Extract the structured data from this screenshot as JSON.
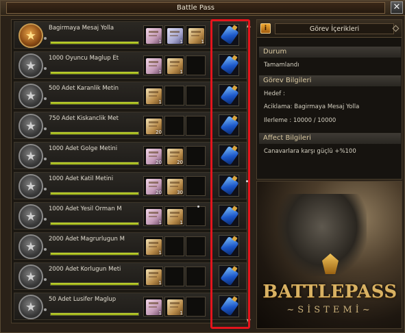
{
  "window": {
    "title": "Battle Pass",
    "close_label": "✕"
  },
  "missions": [
    {
      "label": "Bagirmaya Mesaj Yolla",
      "medal": "gold",
      "progress": 1.0,
      "rewards": [
        {
          "type": "pink",
          "qty": "1"
        },
        {
          "type": "lav",
          "qty": "1"
        },
        {
          "type": "gold",
          "qty": "1"
        }
      ]
    },
    {
      "label": "1000 Oyuncu Maglup Et",
      "medal": "silver",
      "progress": 1.0,
      "rewards": [
        {
          "type": "pink",
          "qty": "1"
        },
        {
          "type": "gold",
          "qty": "1"
        },
        null
      ]
    },
    {
      "label": "500 Adet Karanlik Metin",
      "medal": "silver",
      "progress": 1.0,
      "rewards": [
        {
          "type": "gold",
          "qty": "1"
        },
        null,
        null
      ]
    },
    {
      "label": "750 Adet Kiskanclik Met",
      "medal": "silver",
      "progress": 1.0,
      "rewards": [
        {
          "type": "gold",
          "qty": "20"
        },
        null,
        null
      ]
    },
    {
      "label": "1000 Adet Golge Metini",
      "medal": "silver",
      "progress": 1.0,
      "rewards": [
        {
          "type": "pink",
          "qty": "20"
        },
        {
          "type": "gold",
          "qty": "20"
        },
        null
      ]
    },
    {
      "label": "1000 Adet Katil Metini",
      "medal": "silver",
      "progress": 1.0,
      "rewards": [
        {
          "type": "pink",
          "qty": "20"
        },
        {
          "type": "gold",
          "qty": "30"
        },
        null
      ]
    },
    {
      "label": "1000 Adet Yesil Orman M",
      "medal": "silver",
      "progress": 1.0,
      "rewards": [
        {
          "type": "pink",
          "qty": "1"
        },
        {
          "type": "gold",
          "qty": "1"
        },
        null
      ]
    },
    {
      "label": "2000 Adet Magrurlugun M",
      "medal": "silver",
      "progress": 1.0,
      "rewards": [
        {
          "type": "gold",
          "qty": "1"
        },
        null,
        null
      ]
    },
    {
      "label": "2000 Adet Korlugun Meti",
      "medal": "silver",
      "progress": 1.0,
      "rewards": [
        {
          "type": "gold",
          "qty": "1"
        },
        null,
        null
      ]
    },
    {
      "label": "50 Adet Lusifer Maglup",
      "medal": "silver",
      "progress": 1.0,
      "rewards": [
        {
          "type": "pink",
          "qty": "1"
        },
        {
          "type": "gold",
          "qty": "1"
        },
        null
      ]
    }
  ],
  "panel": {
    "title": "Görev İçerikleri",
    "status_header": "Durum",
    "status_value": "Tamamlandı",
    "info_header": "Görev Bilgileri",
    "target_label": "Hedef :",
    "description": "Aciklama: Bagirmaya Mesaj Yolla",
    "progress": "Ilerleme : 10000 / 10000",
    "affect_header": "Affect Bilgileri",
    "affect_value": "Canavarlara karşı güçlü +%100"
  },
  "banner": {
    "title": "BATTLEPASS",
    "subtitle": "~SİSTEMİ~"
  },
  "colors": {
    "highlight": "#e5141c",
    "progress": "#b8cf2a",
    "accent": "#d9b263"
  }
}
